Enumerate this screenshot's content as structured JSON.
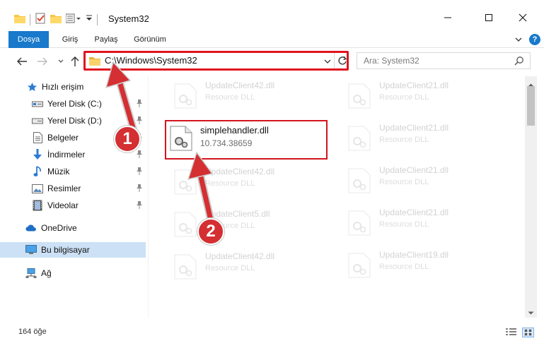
{
  "window": {
    "title": "System32",
    "min_icon": "minimize-icon",
    "max_icon": "maximize-icon",
    "close_icon": "close-icon"
  },
  "ribbon": {
    "tabs": [
      {
        "label": "Dosya",
        "active": true
      },
      {
        "label": "Giriş",
        "active": false
      },
      {
        "label": "Paylaş",
        "active": false
      },
      {
        "label": "Görünüm",
        "active": false
      }
    ],
    "help": "?"
  },
  "address": {
    "path": "C:\\Windows\\System32"
  },
  "search": {
    "placeholder": "Ara: System32"
  },
  "nav": {
    "items": [
      {
        "label": "Hızlı erişim",
        "icon": "star-icon",
        "pinned": false
      },
      {
        "label": "Yerel Disk (C:)",
        "icon": "drive-icon",
        "pinned": true
      },
      {
        "label": "Yerel Disk (D:)",
        "icon": "drive-icon",
        "pinned": true
      },
      {
        "label": "Belgeler",
        "icon": "document-icon",
        "pinned": true
      },
      {
        "label": "İndirmeler",
        "icon": "download-icon",
        "pinned": true
      },
      {
        "label": "Müzik",
        "icon": "music-icon",
        "pinned": true
      },
      {
        "label": "Resimler",
        "icon": "pictures-icon",
        "pinned": true
      },
      {
        "label": "Videolar",
        "icon": "video-icon",
        "pinned": true
      },
      {
        "label": "OneDrive",
        "icon": "cloud-icon",
        "pinned": false
      },
      {
        "label": "Bu bilgisayar",
        "icon": "computer-icon",
        "pinned": false,
        "selected": true
      },
      {
        "label": "Ağ",
        "icon": "network-icon",
        "pinned": false
      }
    ]
  },
  "files": {
    "highlighted": {
      "name": "simplehandler.dll",
      "detail": "10.734.38659"
    },
    "left": [
      {
        "name": "UpdateClient42.dll",
        "detail": "Resource DLL"
      },
      {
        "name": "UpdateClient42.dll",
        "detail": "Resource DLL"
      },
      {
        "name": "UpdateClient5.dll",
        "detail": "Resource DLL"
      },
      {
        "name": "UpdateClient42.dll",
        "detail": "Resource DLL"
      }
    ],
    "right": [
      {
        "name": "UpdateClient21.dll",
        "detail": "Resource DLL"
      },
      {
        "name": "UpdateClient21.dll",
        "detail": "Resource DLL"
      },
      {
        "name": "UpdateClient21.dll",
        "detail": "Resource DLL"
      },
      {
        "name": "UpdateClient21.dll",
        "detail": "Resource DLL"
      },
      {
        "name": "UpdateClient19.dll",
        "detail": "Resource DLL"
      }
    ]
  },
  "status": {
    "count": "164 öğe"
  },
  "annotations": {
    "step1": "1",
    "step2": "2",
    "color": "#d42f32"
  },
  "colors": {
    "accent": "#1979ca",
    "highlight": "#d4141d",
    "selected_bg": "#cce1f5"
  }
}
